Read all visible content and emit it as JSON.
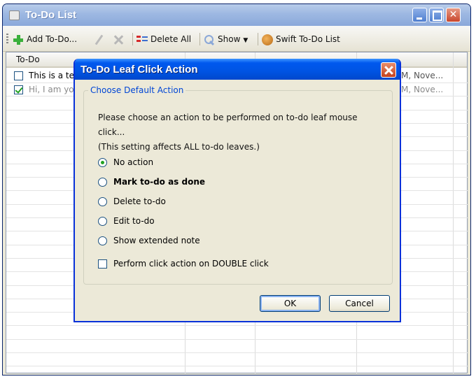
{
  "window": {
    "title": "To-Do List"
  },
  "toolbar": {
    "add_label": "Add To-Do...",
    "delete_all_label": "Delete All",
    "show_label": "Show",
    "swift_label": "Swift To-Do List"
  },
  "list": {
    "header": "To-Do",
    "rows": [
      {
        "text": "This is a te",
        "date": "M, Nove...",
        "checked": false
      },
      {
        "text": "Hi, I am yo",
        "date": "M, Nove...",
        "checked": true
      }
    ]
  },
  "dialog": {
    "title": "To-Do Leaf Click Action",
    "group_label": "Choose Default Action",
    "description_line1": "Please choose an action to be performed on to-do leaf mouse click...",
    "description_line2": "(This setting affects ALL to-do leaves.)",
    "options": [
      {
        "label": "No action",
        "selected": true
      },
      {
        "label": "Mark to-do as done",
        "selected": false
      },
      {
        "label": "Delete to-do",
        "selected": false
      },
      {
        "label": "Edit to-do",
        "selected": false
      },
      {
        "label": "Show extended note",
        "selected": false
      }
    ],
    "double_click_label": "Perform click action on DOUBLE click",
    "double_click_checked": false,
    "ok_label": "OK",
    "cancel_label": "Cancel"
  }
}
